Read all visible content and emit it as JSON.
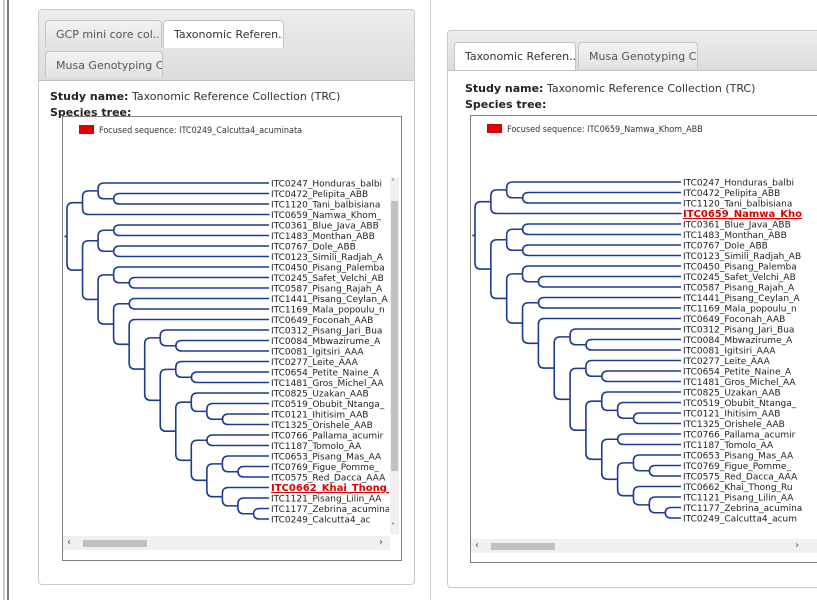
{
  "colors": {
    "branch": "#1f3a93",
    "focus": "#e00000",
    "leaf_text": "#222222"
  },
  "left": {
    "tabs": [
      {
        "label": "GCP mini core col...",
        "active": false
      },
      {
        "label": "Taxonomic Referen...",
        "active": true
      },
      {
        "label": "Musa Genotyping C...",
        "active": false
      }
    ],
    "study_label": "Study name:",
    "study_value": "Taxonomic Reference Collection (TRC)",
    "species_label": "Species tree:",
    "legend": "Focused sequence: ITC0249_Calcutta4_acuminata",
    "focus_index": 29,
    "leaves": [
      "ITC0247_Honduras_balbi",
      "ITC0472_Pelipita_ABB",
      "ITC1120_Tani_balbisiana",
      "ITC0659_Namwa_Khom_",
      "ITC0361_Blue_Java_ABB",
      "ITC1483_Monthan_ABB",
      "ITC0767_Dole_ABB",
      "ITC0123_Simili_Radjah_A",
      "ITC0450_Pisang_Palemba",
      "ITC0245_Safet_Velchi_AB",
      "ITC0587_Pisang_Rajah_A",
      "ITC1441_Pisang_Ceylan_A",
      "ITC1169_Mala_popoulu_n",
      "ITC0649_Foconah_AAB",
      "ITC0312_Pisang_Jari_Bua",
      "ITC0084_Mbwazirume_A",
      "ITC0081_Igitsiri_AAA",
      "ITC0277_Leite_AAA",
      "ITC0654_Petite_Naine_A",
      "ITC1481_Gros_Michel_AA",
      "ITC0825_Uzakan_AAB",
      "ITC0519_Obubit_Ntanga_",
      "ITC0121_Ihitisim_AAB",
      "ITC1325_Orishele_AAB",
      "ITC0766_Pallama_acumir",
      "ITC1187_Tomolo_AA",
      "ITC0653_Pisang_Mas_AA",
      "ITC0769_Figue_Pomme_",
      "ITC0575_Red_Dacca_AAA",
      "ITC0662_Khai_Thong_Ru",
      "ITC1121_Pisang_Lilin_AA",
      "ITC1177_Zebrina_acumina",
      "ITC0249_Calcutta4_ac"
    ]
  },
  "right": {
    "tabs": [
      {
        "label": "Taxonomic Referen...",
        "active": true
      },
      {
        "label": "Musa Genotyping C...",
        "active": false
      }
    ],
    "study_label": "Study name:",
    "study_value": "Taxonomic Reference Collection (TRC)",
    "species_label": "Species tree:",
    "legend": "Focused sequence: ITC0659_Namwa_Khom_ABB",
    "focus_index": 3,
    "leaves": [
      "ITC0247_Honduras_balbi",
      "ITC0472_Pelipita_ABB",
      "ITC1120_Tani_balbisiana",
      "ITC0659_Namwa_Kho",
      "ITC0361_Blue_Java_ABB",
      "ITC1483_Monthan_ABB",
      "ITC0767_Dole_ABB",
      "ITC0123_Simili_Radjah_AB",
      "ITC0450_Pisang_Palemba",
      "ITC0245_Safet_Velchi_AB",
      "ITC0587_Pisang_Rajah_A",
      "ITC1441_Pisang_Ceylan_A",
      "ITC1169_Mala_popoulu_n",
      "ITC0649_Foconah_AAB",
      "ITC0312_Pisang_Jari_Bua",
      "ITC0084_Mbwazirume_A",
      "ITC0081_Igitsiri_AAA",
      "ITC0277_Leite_AAA",
      "ITC0654_Petite_Naine_A",
      "ITC1481_Gros_Michel_AA",
      "ITC0825_Uzakan_AAB",
      "ITC0519_Obubit_Ntanga_",
      "ITC0121_Ihitisim_AAB",
      "ITC1325_Orishele_AAB",
      "ITC0766_Pallama_acumir",
      "ITC1187_Tomolo_AA",
      "ITC0653_Pisang_Mas_AA",
      "ITC0769_Figue_Pomme_",
      "ITC0575_Red_Dacca_AAA",
      "ITC0662_Khai_Thong_Ru",
      "ITC1121_Pisang_Lilin_AA",
      "ITC1177_Zebrina_acumina",
      "ITC0249_Calcutta4_acum"
    ]
  }
}
